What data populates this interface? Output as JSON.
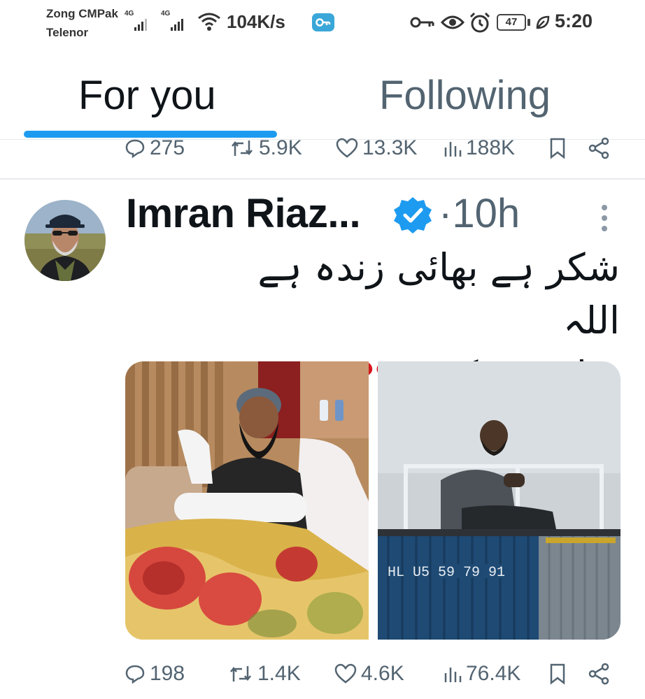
{
  "status_bar": {
    "carrier_1": "Zong CMPak",
    "carrier_2": "Telenor",
    "network_1": "4G",
    "network_2": "4G",
    "net_speed": "104K/s",
    "battery": "47",
    "time": "5:20",
    "icons": [
      "signal-icon",
      "wifi-icon",
      "vpn-key-icon",
      "key-icon",
      "eye-icon",
      "alarm-icon",
      "battery-icon",
      "leaf-icon"
    ]
  },
  "tabs": [
    {
      "label": "For you",
      "active": true
    },
    {
      "label": "Following",
      "active": false
    }
  ],
  "previous_post_actions": {
    "replies": "275",
    "reposts": "5.9K",
    "likes": "13.3K",
    "views": "188K"
  },
  "post": {
    "author": "Imran Riaz...",
    "verified": true,
    "separator": "·",
    "time": "10h",
    "text_line_1": "شکر ہے بھائی زندہ ہے اللہ",
    "text_line_2": "سلامت رکھے",
    "hearts": "❤❤",
    "media": [
      {
        "name": "hospital-photo",
        "caption": ""
      },
      {
        "name": "container-photo",
        "overlay_text": "HL U5 59 79 91"
      }
    ],
    "actions": {
      "replies": "198",
      "reposts": "1.4K",
      "likes": "4.6K",
      "views": "76.4K"
    }
  },
  "colors": {
    "accent": "#1d9bf0",
    "text_primary": "#0f1419",
    "text_secondary": "#536471",
    "heart": "#d4171d",
    "divider": "#e6e9ec"
  }
}
